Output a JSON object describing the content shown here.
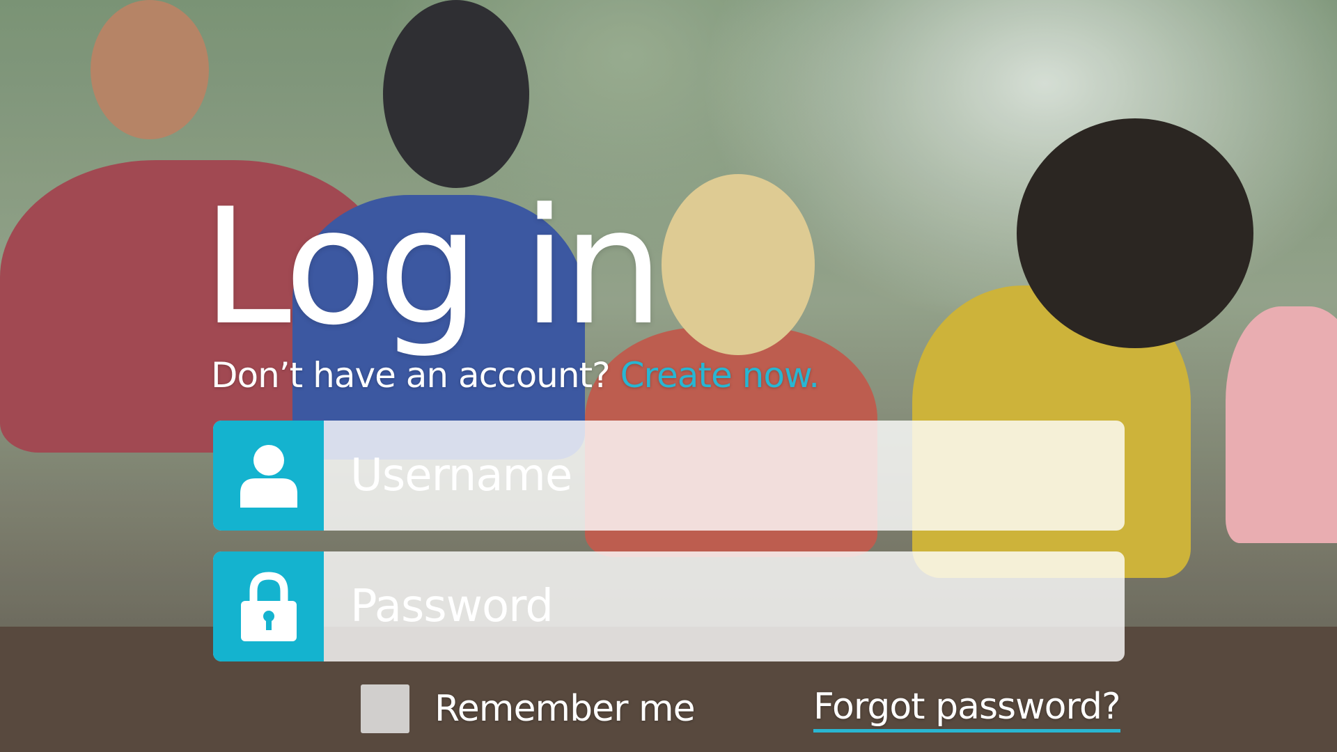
{
  "page": {
    "title": "Log in",
    "signup_prompt": "Don’t have an account?",
    "signup_link": "Create now."
  },
  "form": {
    "username": {
      "placeholder": "Username",
      "value": "",
      "icon": "user-icon"
    },
    "password": {
      "placeholder": "Password",
      "value": "",
      "icon": "lock-icon"
    },
    "remember_label": "Remember me",
    "remember_checked": false,
    "forgot_label": "Forgot password?"
  },
  "colors": {
    "accent": "#14b3cf",
    "link": "#28b6d2",
    "text": "#ffffff"
  }
}
